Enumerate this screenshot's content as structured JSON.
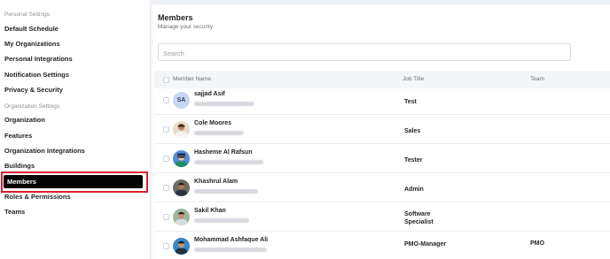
{
  "sidebar": {
    "personal_settings_title": "Personal Settings",
    "personal_items": [
      {
        "label": "Default Schedule"
      },
      {
        "label": "My Organizations"
      },
      {
        "label": "Personal Integrations"
      },
      {
        "label": "Notification Settings"
      },
      {
        "label": "Privacy & Security"
      }
    ],
    "organization_settings_title": "Organization Settings",
    "organization_items": [
      {
        "label": "Organization"
      },
      {
        "label": "Features"
      },
      {
        "label": "Organization Integrations"
      },
      {
        "label": "Buildings"
      },
      {
        "label": "Members"
      },
      {
        "label": "Roles & Permissions"
      },
      {
        "label": "Teams"
      }
    ],
    "active_item": "Members"
  },
  "main": {
    "title": "Members",
    "subtitle": "Manage your security",
    "search": {
      "placeholder": "Search",
      "value": ""
    },
    "columns": {
      "name": "Member Name",
      "job": "Job Title",
      "team": "Team"
    },
    "members": [
      {
        "name": "sajjad Asif",
        "initials": "SA",
        "job": "Test",
        "team": ""
      },
      {
        "name": "Cole Moores",
        "job": "Sales",
        "team": ""
      },
      {
        "name": "Hasheme Al Rafsun",
        "job": "Tester",
        "team": ""
      },
      {
        "name": "Khashrul Alam",
        "job": "Admin",
        "team": ""
      },
      {
        "name": "Sakil Khan",
        "job_line1": "Software",
        "job_line2": "Specialist",
        "team": ""
      },
      {
        "name": "Mohammad Ashfaque Ali",
        "job": "PMO-Manager",
        "team": "PMO"
      }
    ]
  },
  "colors": {
    "active_nav_bg": "#050505",
    "highlight_frame": "#d4202f",
    "initials_avatar_bg": "#c7d7f3"
  }
}
